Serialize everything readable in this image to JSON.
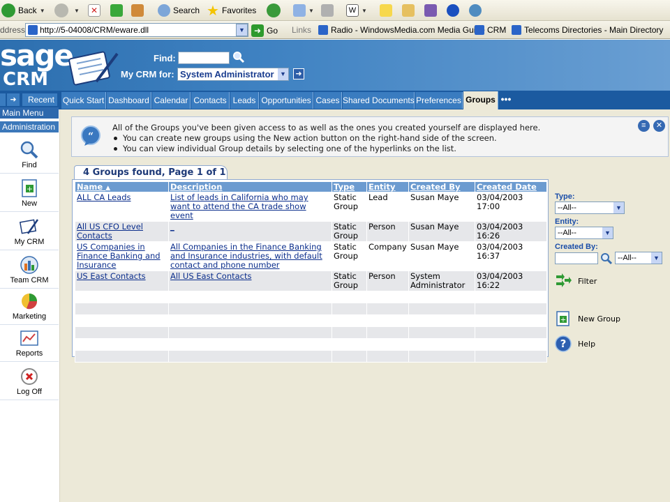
{
  "browser": {
    "toolbar": {
      "back_label": "Back",
      "search_label": "Search",
      "favorites_label": "Favorites"
    },
    "address": {
      "label": "ddress",
      "url": "http://5-04008/CRM/eware.dll",
      "go_label": "Go"
    },
    "links": {
      "label": "Links",
      "items": [
        "Radio - WindowsMedia.com Media Guide",
        "CRM",
        "Telecoms Directories - Main Directory"
      ]
    }
  },
  "header": {
    "logo_top": "sage",
    "logo_bottom": "CRM",
    "find_label": "Find:",
    "find_value": "",
    "mycrm_label": "My CRM for:",
    "mycrm_selected": "System Administrator"
  },
  "tabs": {
    "recent_label": "Recent",
    "items": [
      "Quick Start",
      "Dashboard",
      "Calendar",
      "Contacts",
      "Leads",
      "Opportunities",
      "Cases",
      "Shared Documents",
      "Preferences",
      "Groups"
    ],
    "more_label": "•••"
  },
  "sidebar": {
    "main_menu": "Main Menu",
    "administration": "Administration",
    "items": [
      "Find",
      "New",
      "My CRM",
      "Team CRM",
      "Marketing",
      "Reports",
      "Log Off"
    ]
  },
  "info": {
    "line1": "All of the Groups you've been given access to as well as the ones you created yourself are displayed here.",
    "line2": "You can create new groups using the New action button on the right-hand side of the screen.",
    "line3": "You can view individual Group details by selecting one of the hyperlinks on the list."
  },
  "results": {
    "caption": "4 Groups found, Page 1 of 1",
    "columns": [
      "Name",
      "Description",
      "Type",
      "Entity",
      "Created By",
      "Created Date"
    ],
    "sort_indicator": "▲",
    "rows": [
      {
        "name": "ALL CA Leads",
        "description": "List of leads in California who may want to attend the CA trade show event",
        "type": "Static Group",
        "entity": "Lead",
        "created_by": "Susan Maye",
        "created_date": "03/04/2003 17:00"
      },
      {
        "name": "All US CFO Level Contacts",
        "description": "_",
        "type": "Static Group",
        "entity": "Person",
        "created_by": "Susan Maye",
        "created_date": "03/04/2003 16:26"
      },
      {
        "name": "US Companies in Finance Banking and Insurance",
        "description": "All Companies in the Finance Banking and Insurance industries, with default contact and phone number",
        "type": "Static Group",
        "entity": "Company",
        "created_by": "Susan Maye",
        "created_date": "03/04/2003 16:37"
      },
      {
        "name": "US East Contacts",
        "description": "All US East Contacts",
        "type": "Static Group",
        "entity": "Person",
        "created_by": "System Administrator",
        "created_date": "03/04/2003 16:22"
      }
    ]
  },
  "filters": {
    "type_label": "Type:",
    "type_value": "--All--",
    "entity_label": "Entity:",
    "entity_value": "--All--",
    "created_by_label": "Created By:",
    "created_by_value": "--All--",
    "filter_label": "Filter",
    "new_group_label": "New Group",
    "help_label": "Help"
  }
}
